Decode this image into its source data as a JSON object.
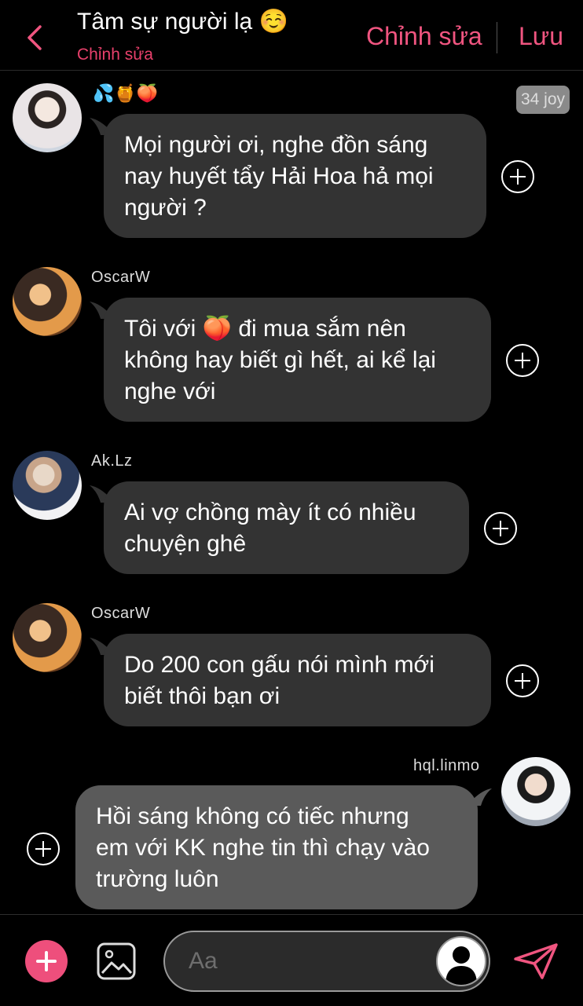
{
  "header": {
    "title": "Tâm sự người lạ ☺️",
    "subtitle": "Chỉnh sửa",
    "edit_label": "Chỉnh sửa",
    "save_label": "Lưu",
    "accent_color": "#f05580"
  },
  "badge": {
    "text": "34 joy"
  },
  "messages": [
    {
      "sender": "💦🍯🍑",
      "text_lines": [
        "Mọi người ơi, nghe đồn sáng",
        "nay huyết tẩy Hải Hoa hả mọi",
        "người ?"
      ]
    },
    {
      "sender": "OscarW",
      "text_lines": [
        "Tôi với 🍑 đi mua sắm nên",
        "không hay biết gì hết, ai kể lại",
        "nghe với"
      ]
    },
    {
      "sender": "Ak.Lz",
      "text_lines": [
        "Ai vợ chồng mày ít có nhiều",
        "chuyện ghê"
      ]
    },
    {
      "sender": "OscarW",
      "text_lines": [
        "Do 200 con gấu nói mình mới",
        "biết thôi bạn ơi"
      ]
    },
    {
      "sender": "hql.linmo",
      "text_lines": [
        "Hồi sáng không có tiếc nhưng",
        "em với KK nghe tin thì chạy vào",
        "trường luôn"
      ]
    }
  ],
  "composer": {
    "placeholder": "Aa"
  },
  "icons": {
    "back": "chevron-left-icon",
    "add": "plus-icon",
    "image": "image-icon",
    "send": "send-icon",
    "add_reaction": "plus-circle-icon"
  }
}
